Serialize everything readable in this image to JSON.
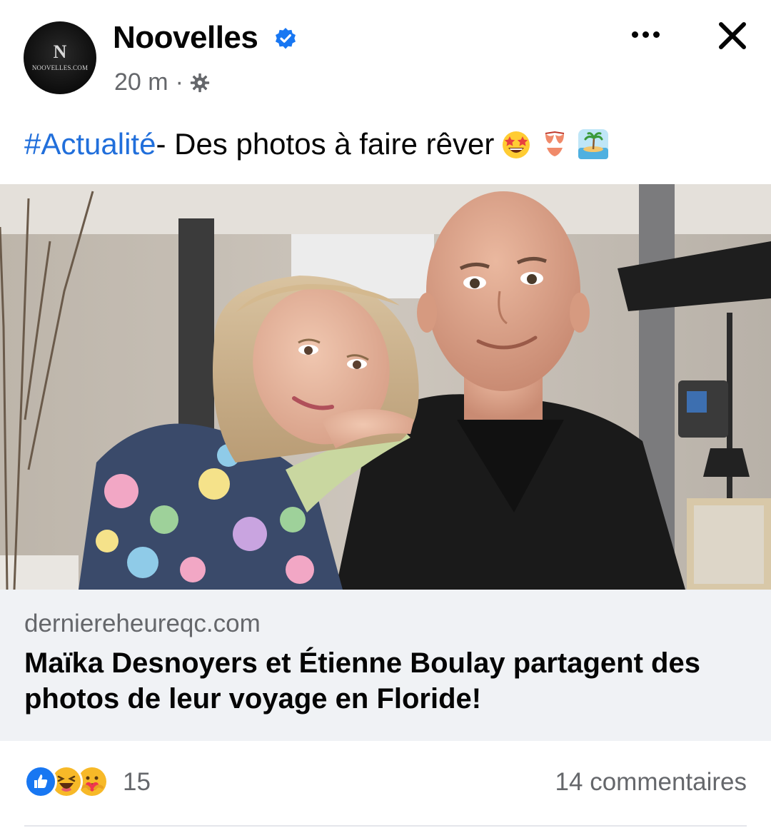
{
  "post": {
    "page_name": "Noovelles",
    "avatar_monogram": "N",
    "avatar_site": "NOOVELLES.COM",
    "timestamp": "20 m",
    "separator": "·",
    "audience_icon": "gear-icon",
    "caption_hashtag": "#Actualité",
    "caption_text": " - Des photos à faire rêver",
    "caption_emojis": [
      "star-struck-emoji",
      "bikini-emoji",
      "desert-island-emoji"
    ]
  },
  "header_actions": {
    "more_icon": "more-options-icon",
    "close_icon": "close-icon"
  },
  "link_preview": {
    "domain": "derniereheureqc.com",
    "headline": "Maïka Desnoyers et Étienne Boulay partagent des photos de leur voyage en Floride!"
  },
  "engagement": {
    "reaction_icons": [
      "like-reaction-icon",
      "haha-reaction-icon",
      "care-reaction-icon"
    ],
    "reaction_count": "15",
    "comments": "14 commentaires"
  },
  "colors": {
    "hashtag": "#216fdb",
    "secondary_text": "#65676b",
    "verified": "#1877f2",
    "link_bg": "#f0f2f5"
  }
}
